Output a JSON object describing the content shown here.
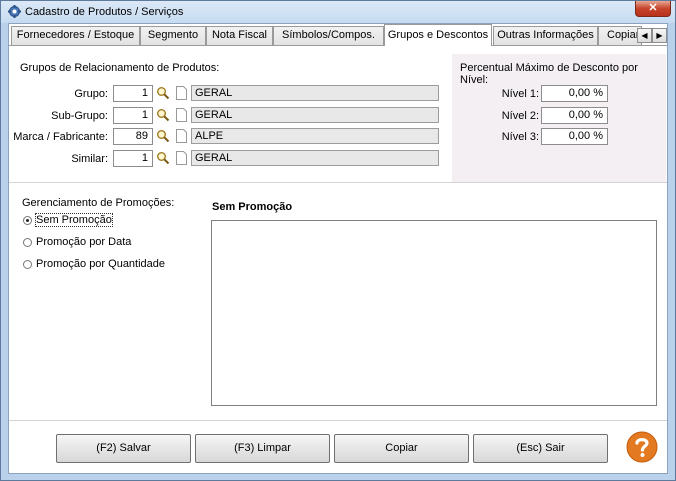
{
  "window": {
    "title": "Cadastro de Produtos / Serviços",
    "close_label": "✕"
  },
  "tabs": [
    {
      "label": "Fornecedores / Estoque",
      "active": false
    },
    {
      "label": "Segmento",
      "active": false
    },
    {
      "label": "Nota Fiscal",
      "active": false
    },
    {
      "label": "Símbolos/Compos.",
      "active": false
    },
    {
      "label": "Grupos e Descontos",
      "active": true
    },
    {
      "label": "Outras Informações",
      "active": false
    },
    {
      "label": "Copiar",
      "active": false
    }
  ],
  "tab_scroll": {
    "left": "◀",
    "right": "▶"
  },
  "groups": {
    "title": "Grupos de Relacionamento de Produtos:",
    "rows": [
      {
        "label": "Grupo:",
        "code": "1",
        "description": "GERAL"
      },
      {
        "label": "Sub-Grupo:",
        "code": "1",
        "description": "GERAL"
      },
      {
        "label": "Marca / Fabricante:",
        "code": "89",
        "description": "ALPE"
      },
      {
        "label": "Similar:",
        "code": "1",
        "description": "GERAL"
      }
    ]
  },
  "discount": {
    "title": "Percentual Máximo de Desconto por Nível:",
    "levels": [
      {
        "label": "Nível 1:",
        "value": "0,00 %"
      },
      {
        "label": "Nível 2:",
        "value": "0,00 %"
      },
      {
        "label": "Nível 3:",
        "value": "0,00 %"
      }
    ]
  },
  "promotions": {
    "title": "Gerenciamento de Promoções:",
    "options": [
      {
        "label": "Sem Promoção",
        "checked": true
      },
      {
        "label": "Promoção por Data",
        "checked": false
      },
      {
        "label": "Promoção por Quantidade",
        "checked": false
      }
    ],
    "panel_title": "Sem Promoção"
  },
  "buttons": {
    "save": "(F2) Salvar",
    "clear": "(F3) Limpar",
    "copy": "Copiar",
    "exit": "(Esc) Sair"
  },
  "icons": {
    "app": "app-gear-icon",
    "search": "search-icon",
    "document": "document-icon",
    "help": "help-icon"
  },
  "colors": {
    "help_orange": "#e37a22",
    "discount_panel_bg": "#f3eff3",
    "window_frame": "#b9d1ea"
  }
}
